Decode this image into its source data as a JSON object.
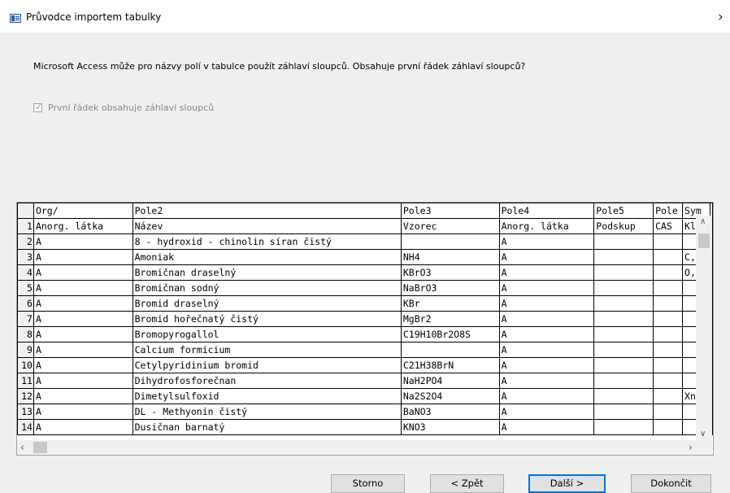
{
  "window": {
    "title": "Průvodce importem tabulky"
  },
  "prompt": {
    "text": "Microsoft Access může pro názvy polí v tabulce použít záhlaví sloupců. Obsahuje první řádek záhlaví sloupců?"
  },
  "header_checkbox": {
    "label": "První řádek obsahuje záhlaví sloupců",
    "checked": true,
    "enabled": false
  },
  "grid": {
    "columns": [
      "Org/",
      "Pole2",
      "Pole3",
      "Pole4",
      "Pole5",
      "Pole",
      "Sym"
    ],
    "rows": [
      {
        "n": "1",
        "c": [
          "Anorg. látka",
          "Název",
          "Vzorec",
          "Anorg. látka",
          "Podskup",
          "CAS",
          "Kla"
        ]
      },
      {
        "n": "2",
        "c": [
          "A",
          "8 - hydroxid - chinolin síran čistý",
          "",
          "A",
          "",
          "",
          ""
        ]
      },
      {
        "n": "3",
        "c": [
          "A",
          "Amoniak",
          "NH4",
          "A",
          "",
          "",
          "C,N"
        ]
      },
      {
        "n": "4",
        "c": [
          "A",
          "Bromičnan draselný",
          "KBrO3",
          "A",
          "",
          "",
          "O,T"
        ]
      },
      {
        "n": "5",
        "c": [
          "A",
          "Bromičnan sodný",
          "NaBrO3",
          "A",
          "",
          "",
          ""
        ]
      },
      {
        "n": "6",
        "c": [
          "A",
          "Bromid draselný",
          "KBr",
          "A",
          "",
          "",
          ""
        ]
      },
      {
        "n": "7",
        "c": [
          "A",
          "Bromid hořečnatý čistý",
          "MgBr2",
          "A",
          "",
          "",
          ""
        ]
      },
      {
        "n": "8",
        "c": [
          "A",
          "Bromopyrogallol",
          "C19H10Br2O8S",
          "A",
          "",
          "",
          ""
        ]
      },
      {
        "n": "9",
        "c": [
          "A",
          "Calcium formicium",
          "",
          "A",
          "",
          "",
          ""
        ]
      },
      {
        "n": "10",
        "c": [
          "A",
          "Cetylpyridinium bromid",
          "C21H38BrN",
          "A",
          "",
          "",
          ""
        ]
      },
      {
        "n": "11",
        "c": [
          "A",
          "Dihydrofosforečnan",
          "NaH2PO4",
          "A",
          "",
          "",
          ""
        ]
      },
      {
        "n": "12",
        "c": [
          "A",
          "Dimetylsulfoxid",
          "Na2S2O4",
          "A",
          "",
          "",
          "Xn"
        ]
      },
      {
        "n": "13",
        "c": [
          "A",
          "DL - Methyonin čistý",
          "BaNO3",
          "A",
          "",
          "",
          ""
        ]
      },
      {
        "n": "14",
        "c": [
          "A",
          "Dusičnan barnatý",
          "KNO3",
          "A",
          "",
          "",
          ""
        ]
      }
    ]
  },
  "buttons": {
    "cancel": "Storno",
    "back": "< Zpět",
    "next": "Další >",
    "finish": "Dokončit"
  },
  "icons": {
    "app": "table-import-icon",
    "close": "close-icon"
  }
}
